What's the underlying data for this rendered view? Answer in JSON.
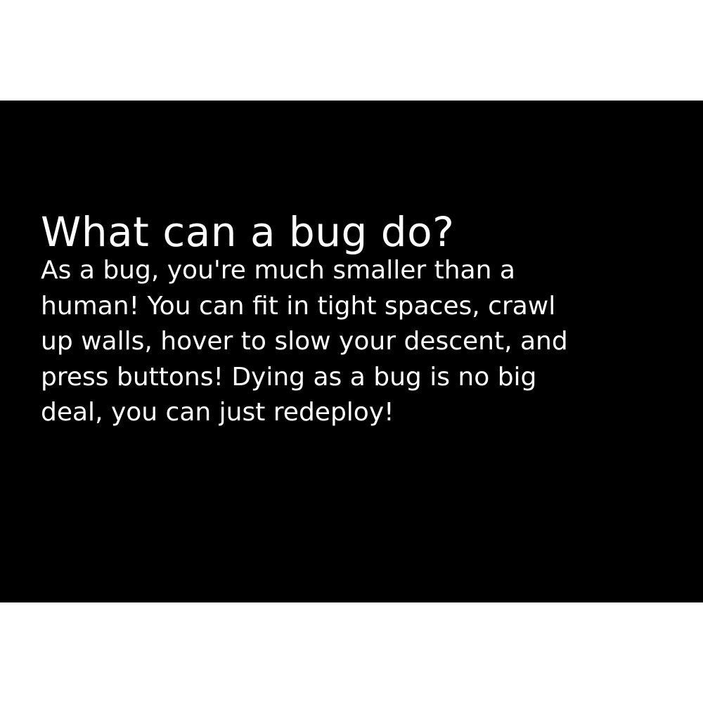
{
  "screen": {
    "background": "#000000",
    "text_color": "#ffffff",
    "title": "What can a bug do?",
    "body": "As a bug, you're much smaller than a\nhuman! You can fit in tight spaces, crawl\nup walls, hover to slow your descent, and\npress buttons! Dying as a bug is no big\ndeal, you can just redeploy!"
  }
}
